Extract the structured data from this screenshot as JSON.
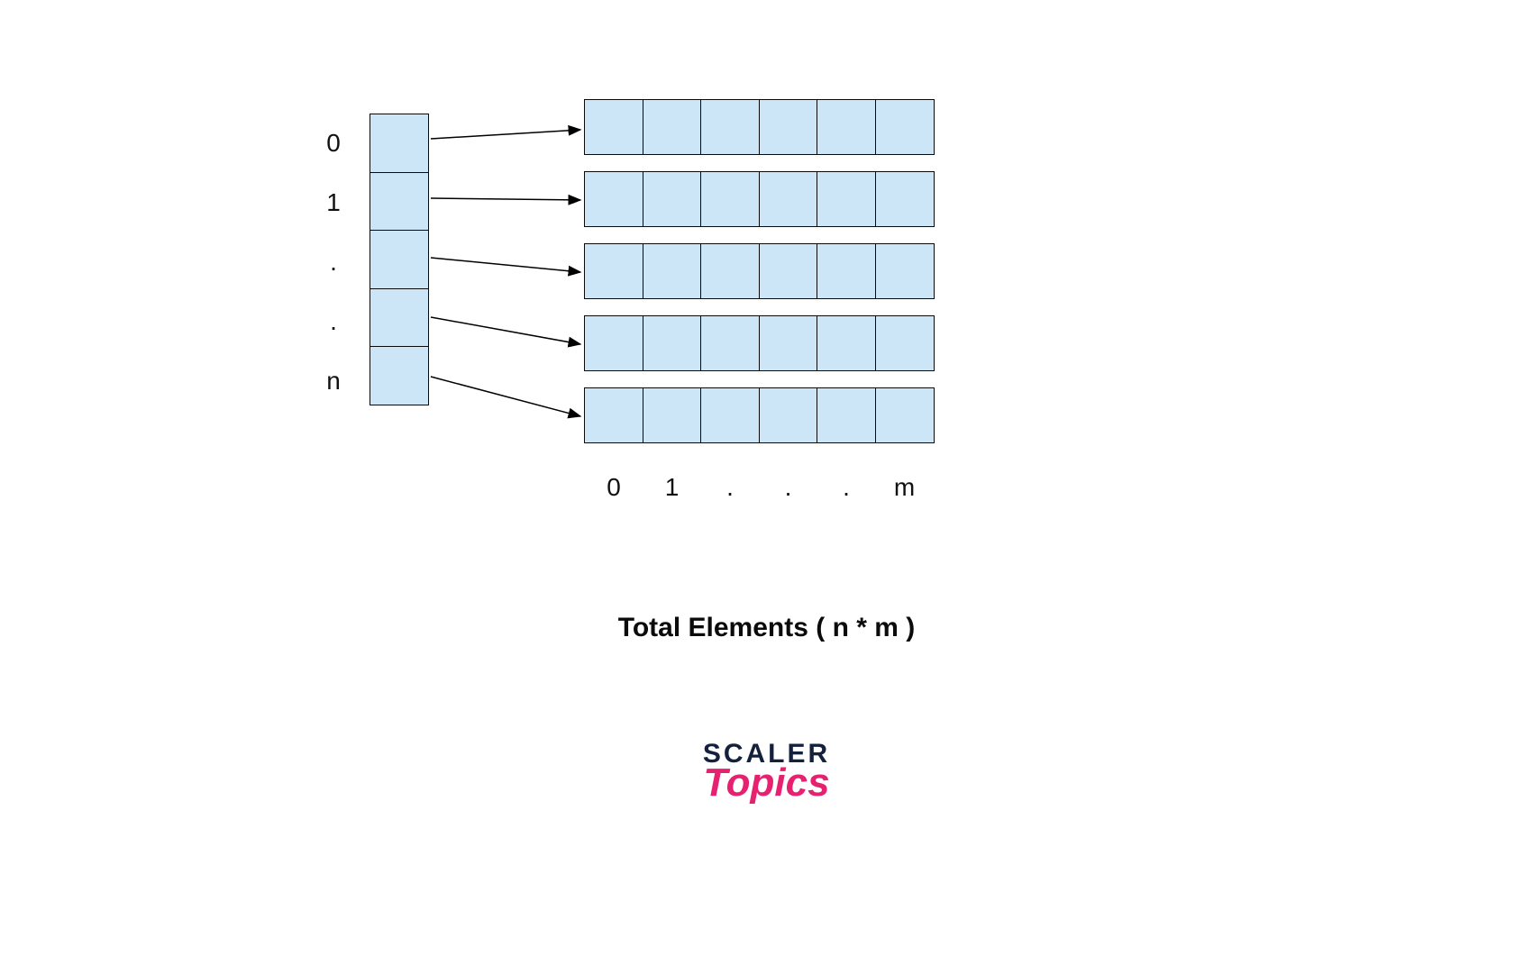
{
  "diagram": {
    "pointer_labels": [
      "0",
      "1",
      ".",
      ".",
      "n"
    ],
    "column_labels": [
      "0",
      "1",
      ".",
      ".",
      ".",
      "m"
    ],
    "row_count": 5,
    "col_count": 6
  },
  "caption": "Total Elements ( n * m )",
  "logo": {
    "line1": "SCALER",
    "line2": "Topics"
  },
  "colors": {
    "cell_fill": "#cde6f7",
    "cell_border": "#0a0a0a",
    "text": "#111111",
    "logo_dark": "#14213d",
    "logo_pink": "#e6216f"
  }
}
